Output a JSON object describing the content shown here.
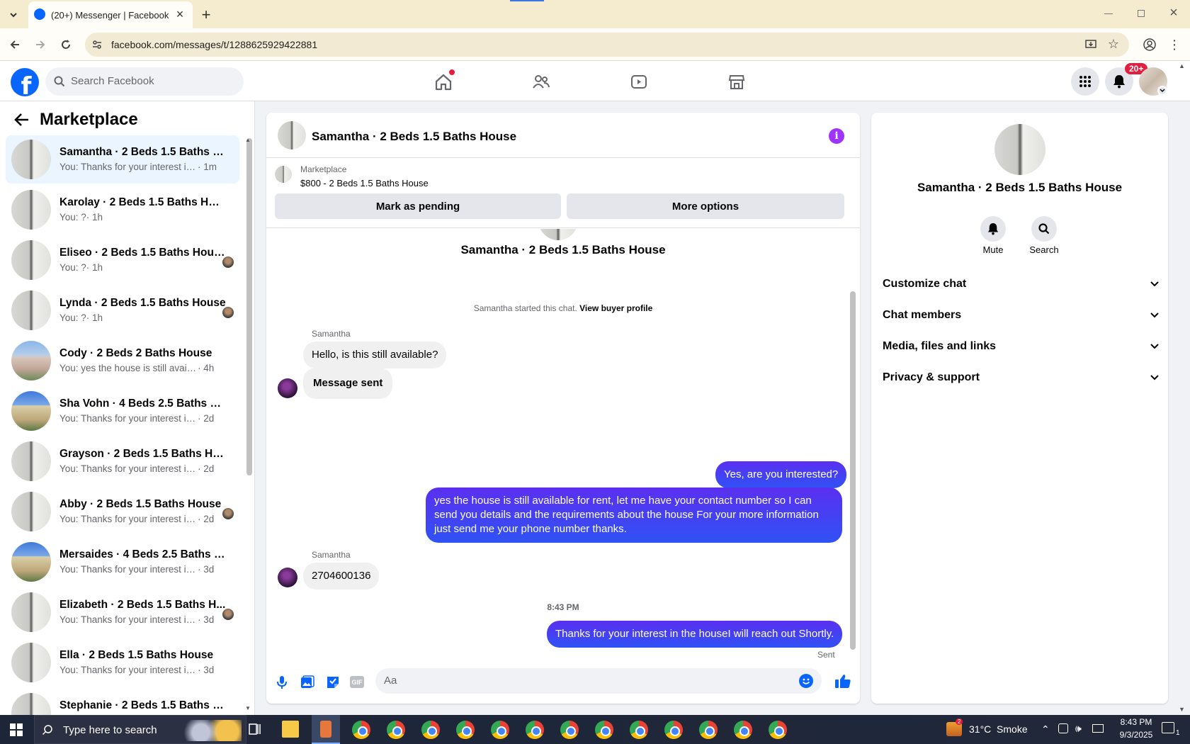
{
  "browser": {
    "tab_title": "(20+) Messenger | Facebook",
    "url": "facebook.com/messages/t/1288625929422881"
  },
  "fb_header": {
    "search_placeholder": "Search Facebook",
    "notification_count": "20+"
  },
  "sidebar": {
    "title": "Marketplace",
    "conversations": [
      {
        "title": "Samantha · 2 Beds 1.5 Baths Ho...",
        "preview": "You: Thanks for your interest in the...",
        "time": "· 1m",
        "thumb": "room"
      },
      {
        "title": "Karolay · 2 Beds 1.5 Baths House",
        "preview": "You: ?",
        "time": "· 1h",
        "thumb": "room"
      },
      {
        "title": "Eliseo · 2 Beds 1.5 Baths House",
        "preview": "You: ?",
        "time": "· 1h",
        "thumb": "room"
      },
      {
        "title": "Lynda · 2 Beds 1.5 Baths House",
        "preview": "You: ?",
        "time": "· 1h",
        "thumb": "room"
      },
      {
        "title": "Cody · 2 Beds 2 Baths House",
        "preview": "You: yes the house is still available f...",
        "time": "· 4h",
        "thumb": "house1"
      },
      {
        "title": "Sha Vohn · 4 Beds 2.5 Baths Hou...",
        "preview": "You: Thanks for your interest in the ...",
        "time": "· 2d",
        "thumb": "house2"
      },
      {
        "title": "Grayson · 2 Beds 1.5 Baths House",
        "preview": "You: Thanks for your interest in the ...",
        "time": "· 2d",
        "thumb": "room"
      },
      {
        "title": "Abby · 2 Beds 1.5 Baths House",
        "preview": "You: Thanks for your interest in t...",
        "time": "· 2d",
        "thumb": "room"
      },
      {
        "title": "Mersaides · 4 Beds 2.5 Baths Ho...",
        "preview": "You: Thanks for your interest in the ...",
        "time": "· 3d",
        "thumb": "house2"
      },
      {
        "title": "Elizabeth · 2 Beds 1.5 Baths H...",
        "preview": "You: Thanks for your interest in t...",
        "time": "· 3d",
        "thumb": "room"
      },
      {
        "title": "Ella · 2 Beds 1.5 Baths House",
        "preview": "You: Thanks for your interest in the ...",
        "time": "· 3d",
        "thumb": "room"
      },
      {
        "title": "Stephanie · 2 Beds 1.5 Baths Hou...",
        "preview": "",
        "time": "",
        "thumb": "room"
      }
    ]
  },
  "chat": {
    "header_title": "Samantha · 2 Beds 1.5 Baths House",
    "listing_label": "Marketplace",
    "listing_detail": "$800 - 2 Beds 1.5 Baths House",
    "mark_pending": "Mark as pending",
    "more_options": "More options",
    "profile_name": "Samantha · 2 Beds 1.5 Baths House",
    "started_text": "Samantha started this chat.",
    "view_profile": "View buyer profile",
    "sender_name": "Samantha",
    "msg1": "Hello, is this still available?",
    "msg2": "Message sent",
    "msg3": "Yes, are you interested?",
    "msg4": "yes the house is still available for rent, let me have your contact number so I can send you details and the requirements about the house For  your  more  information  just  send  me   your  phone  number thanks.",
    "sender_name2": "Samantha",
    "msg5": "2704600136",
    "timestamp": "8:43 PM",
    "msg6": "Thanks for your interest in the houseI will reach out Shortly.",
    "sent_label": "Sent",
    "composer_placeholder": "Aa"
  },
  "right_panel": {
    "name": "Samantha · 2 Beds 1.5 Baths House",
    "mute": "Mute",
    "search": "Search",
    "sections": [
      "Customize chat",
      "Chat members",
      "Media, files and links",
      "Privacy & support"
    ]
  },
  "taskbar": {
    "search_placeholder": "Type here to search",
    "weather": "31°C  Smoke",
    "time": "8:43 PM",
    "date": "9/3/2025",
    "weather_badge": "2",
    "notif_count": "1"
  }
}
